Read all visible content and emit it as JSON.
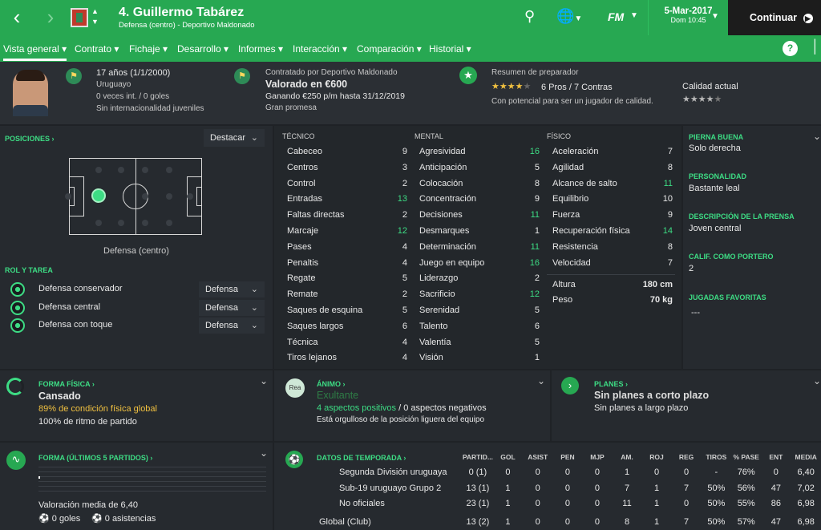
{
  "header": {
    "player_name": "4. Guillermo Tabárez",
    "player_subtitle": "Defensa (centro) - Deportivo Maldonado",
    "fm_label": "FM",
    "date": "5-Mar-2017",
    "time": "Dom 10:45",
    "continue_label": "Continuar"
  },
  "tabs": [
    "Vista general",
    "Contrato",
    "Fichaje",
    "Desarrollo",
    "Informes",
    "Interacción",
    "Comparación",
    "Historial"
  ],
  "profile": {
    "age": "17 años (1/1/2000)",
    "nationality": "Uruguayo",
    "caps": "0 veces int. / 0 goles",
    "youth": "Sin internacionalidad juveniles",
    "contract_label": "Contratado por Deportivo Maldonado",
    "value": "Valorado en €600",
    "wage": "Ganando €250 p/m hasta 31/12/2019",
    "promise": "Gran promesa",
    "coach_title": "Resumen de preparador",
    "pros_cons": "6 Pros / 7 Contras",
    "potential": "Con potencial para ser un jugador de calidad.",
    "current_ability_label": "Calidad actual",
    "potential_stars": 3.5,
    "current_stars": 4.5
  },
  "positions": {
    "title": "POSICIONES",
    "highlight_label": "Destacar",
    "position_name": "Defensa (centro)"
  },
  "roles": {
    "title": "ROL Y TAREA",
    "items": [
      {
        "name": "Defensa conservador",
        "duty": "Defensa"
      },
      {
        "name": "Defensa central",
        "duty": "Defensa"
      },
      {
        "name": "Defensa con toque",
        "duty": "Defensa"
      }
    ]
  },
  "attributes": {
    "technical_title": "TÉCNICO",
    "mental_title": "MENTAL",
    "physical_title": "FÍSICO",
    "technical": [
      {
        "name": "Cabeceo",
        "value": "9"
      },
      {
        "name": "Centros",
        "value": "3"
      },
      {
        "name": "Control",
        "value": "2"
      },
      {
        "name": "Entradas",
        "value": "13"
      },
      {
        "name": "Faltas directas",
        "value": "2"
      },
      {
        "name": "Marcaje",
        "value": "12"
      },
      {
        "name": "Pases",
        "value": "4"
      },
      {
        "name": "Penaltis",
        "value": "4"
      },
      {
        "name": "Regate",
        "value": "5"
      },
      {
        "name": "Remate",
        "value": "2"
      },
      {
        "name": "Saques de esquina",
        "value": "5"
      },
      {
        "name": "Saques largos",
        "value": "6"
      },
      {
        "name": "Técnica",
        "value": "4"
      },
      {
        "name": "Tiros lejanos",
        "value": "4"
      }
    ],
    "mental": [
      {
        "name": "Agresividad",
        "value": "16"
      },
      {
        "name": "Anticipación",
        "value": "5"
      },
      {
        "name": "Colocación",
        "value": "8"
      },
      {
        "name": "Concentración",
        "value": "9"
      },
      {
        "name": "Decisiones",
        "value": "11"
      },
      {
        "name": "Desmarques",
        "value": "1"
      },
      {
        "name": "Determinación",
        "value": "11"
      },
      {
        "name": "Juego en equipo",
        "value": "16"
      },
      {
        "name": "Liderazgo",
        "value": "2"
      },
      {
        "name": "Sacrificio",
        "value": "12"
      },
      {
        "name": "Serenidad",
        "value": "5"
      },
      {
        "name": "Talento",
        "value": "6"
      },
      {
        "name": "Valentía",
        "value": "5"
      },
      {
        "name": "Visión",
        "value": "1"
      }
    ],
    "physical": [
      {
        "name": "Aceleración",
        "value": "7"
      },
      {
        "name": "Agilidad",
        "value": "8"
      },
      {
        "name": "Alcance de salto",
        "value": "11"
      },
      {
        "name": "Equilibrio",
        "value": "10"
      },
      {
        "name": "Fuerza",
        "value": "9"
      },
      {
        "name": "Recuperación física",
        "value": "14"
      },
      {
        "name": "Resistencia",
        "value": "8"
      },
      {
        "name": "Velocidad",
        "value": "7"
      }
    ],
    "height_label": "Altura",
    "height": "180 cm",
    "weight_label": "Peso",
    "weight": "70 kg"
  },
  "side_info": {
    "foot_title": "PIERNA BUENA",
    "foot": "Solo derecha",
    "personality_title": "PERSONALIDAD",
    "personality": "Bastante leal",
    "press_title": "DESCRIPCIÓN DE LA PRENSA",
    "press": "Joven central",
    "gk_title": "CALIF. COMO PORTERO",
    "gk": "2",
    "moves_title": "JUGADAS FAVORITAS",
    "moves": "---"
  },
  "fitness": {
    "title": "FORMA FÍSICA",
    "status": "Cansado",
    "condition": "89% de condición física global",
    "match_sharpness": "100% de ritmo de partido"
  },
  "morale": {
    "title": "ÁNIMO",
    "badge": "Rea",
    "status": "Exultante",
    "positives": "4 aspectos positivos",
    "negatives": "/ 0 aspectos negativos",
    "note": "Está orgulloso de la posición liguera del equipo"
  },
  "plans": {
    "title": "PLANES",
    "short_term": "Sin planes a corto plazo",
    "long_term": "Sin planes a largo plazo"
  },
  "form": {
    "title": "FORMA (ÚLTIMOS 5 PARTIDOS)",
    "avg_rating": "Valoración media de 6,40",
    "goals": "0 goles",
    "assists": "0 asistencias"
  },
  "season": {
    "title": "DATOS DE TEMPORADA",
    "columns": [
      "PARTID...",
      "GOL",
      "ASIST",
      "PEN",
      "MJP",
      "AM.",
      "ROJ",
      "REG",
      "TIROS",
      "% PASE",
      "ENT",
      "MEDIA"
    ],
    "rows": [
      {
        "name": "Segunda División uruguaya",
        "cells": [
          "0 (1)",
          "0",
          "0",
          "0",
          "0",
          "1",
          "0",
          "0",
          "-",
          "76%",
          "0",
          "6,40"
        ]
      },
      {
        "name": "Sub-19 uruguayo Grupo 2",
        "cells": [
          "13 (1)",
          "1",
          "0",
          "0",
          "0",
          "7",
          "1",
          "7",
          "50%",
          "56%",
          "47",
          "7,02"
        ]
      },
      {
        "name": "No oficiales",
        "cells": [
          "23 (1)",
          "1",
          "0",
          "0",
          "0",
          "11",
          "1",
          "0",
          "50%",
          "55%",
          "86",
          "6,98"
        ]
      },
      {
        "name": "Global (Club)",
        "cells": [
          "13 (2)",
          "1",
          "0",
          "0",
          "0",
          "8",
          "1",
          "7",
          "50%",
          "57%",
          "47",
          "6,98"
        ]
      }
    ]
  }
}
